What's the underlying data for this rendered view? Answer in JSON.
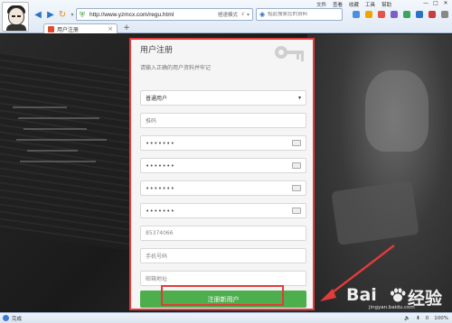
{
  "browser": {
    "url": "http://www.yzmcx.com/regu.html",
    "mode_label": "極速模式",
    "search_placeholder": "點此搜索您的資料",
    "menu": [
      "文件",
      "查看",
      "收藏",
      "工具",
      "幫助"
    ],
    "tab_title": "用户注册",
    "window_controls": [
      "—",
      "□",
      "✕"
    ],
    "status_text": "完成",
    "zoom": "100%",
    "status_badge": "0"
  },
  "form": {
    "title": "用户注册",
    "subtitle": "请输入正确的用户资料并牢记",
    "account_type": "普通用户",
    "invite_placeholder": "推码",
    "password_mask": "•••••••",
    "qq_value": "85374066",
    "phone_placeholder": "手机号码",
    "email_placeholder": "邮箱地址",
    "submit_label": "注册新用户"
  },
  "watermark": {
    "brand_left": "Bai",
    "brand_right": "经验",
    "url": "jingyan.baidu.com"
  },
  "colors": {
    "accent_red": "#e23b3b",
    "submit_green": "#4cae4c",
    "link_blue": "#2c72c7"
  }
}
